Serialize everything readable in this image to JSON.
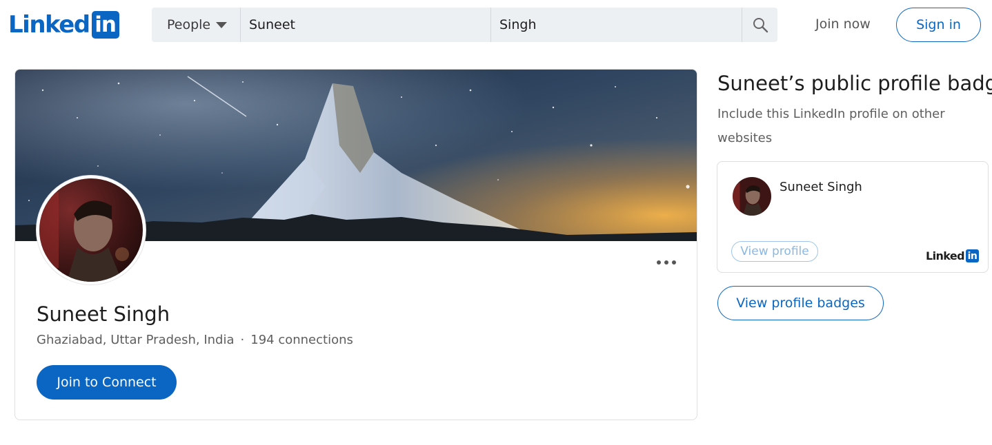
{
  "header": {
    "logo_text": "Linked",
    "logo_box_text": "in",
    "search": {
      "type_label": "People",
      "first_name_value": "Suneet",
      "last_name_value": "Singh",
      "icon": "search-icon"
    },
    "join_now_label": "Join now",
    "sign_in_label": "Sign in"
  },
  "profile": {
    "name": "Suneet Singh",
    "location": "Ghaziabad, Uttar Pradesh, India",
    "separator": "·",
    "connections": "194 connections",
    "connect_label": "Join to Connect",
    "more_icon": "ellipsis-icon"
  },
  "badge": {
    "title": "Suneet’s public profile badge",
    "subtitle": "Include this LinkedIn profile on other websites",
    "card": {
      "name": "Suneet Singh",
      "view_profile_label": "View profile",
      "logo_text": "Linked",
      "logo_box_text": "in"
    },
    "view_badges_label": "View profile badges"
  },
  "colors": {
    "brand": "#0a66c2",
    "text_primary": "#1d1d1d",
    "text_secondary": "#5e5e5e",
    "search_bg": "#edf0f3"
  }
}
